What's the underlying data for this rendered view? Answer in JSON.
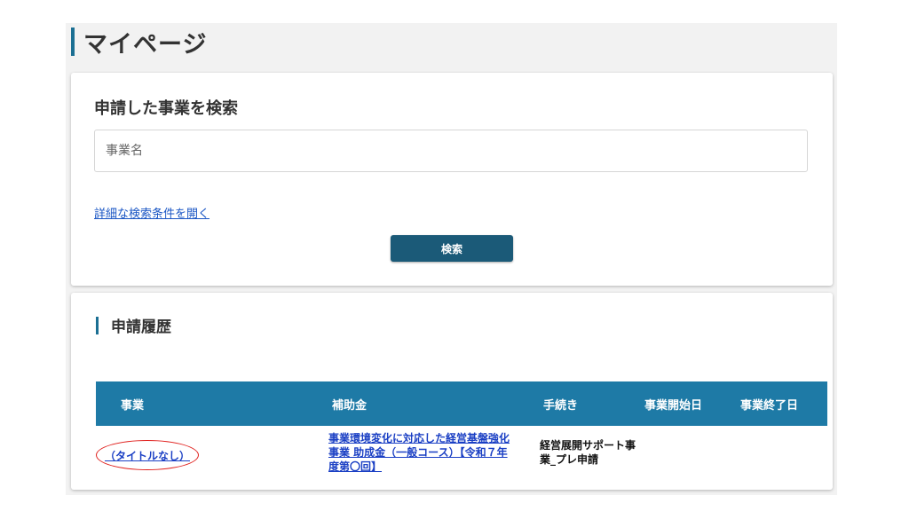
{
  "page": {
    "title": "マイページ"
  },
  "search": {
    "heading": "申請した事業を検索",
    "input_placeholder": "事業名",
    "advanced_link": "詳細な検索条件を開く",
    "button_label": "検索"
  },
  "history": {
    "heading": "申請履歴",
    "columns": [
      "事業",
      "補助金",
      "手続き",
      "事業開始日",
      "事業終了日"
    ],
    "rows": [
      {
        "project": "（タイトルなし）",
        "subsidy": "事業環境変化に対応した経営基盤強化事業 助成金（一般コース）【令和７年度第〇回】",
        "procedure": "経営展開サポート事業_プレ申請",
        "start_date": "",
        "end_date": ""
      }
    ]
  },
  "colors": {
    "accent": "#1b6f93",
    "table_header": "#1e7aa6",
    "button": "#1b5a78",
    "link": "#1a3fc4",
    "highlight_ellipse": "#e0201d"
  }
}
